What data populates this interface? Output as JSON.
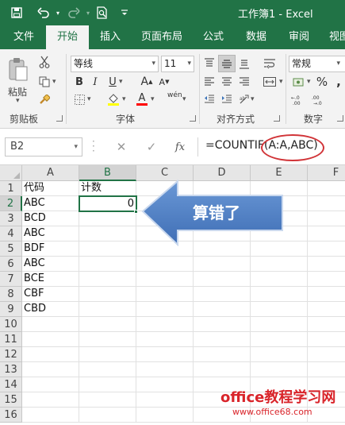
{
  "app": {
    "window_title": "工作簿1 - Excel"
  },
  "quick_access": {
    "save_icon": "save-icon",
    "undo_icon": "undo-icon",
    "redo_icon": "redo-icon",
    "preview_icon": "print-preview-icon",
    "customize_icon": "customize-qat-icon"
  },
  "tabs": [
    {
      "label": "文件"
    },
    {
      "label": "开始"
    },
    {
      "label": "插入"
    },
    {
      "label": "页面布局"
    },
    {
      "label": "公式"
    },
    {
      "label": "数据"
    },
    {
      "label": "审阅"
    },
    {
      "label": "视图"
    }
  ],
  "ribbon": {
    "clipboard": {
      "label": "剪贴板",
      "paste_label": "粘贴"
    },
    "font": {
      "label": "字体",
      "font_name": "等线",
      "font_size": "11",
      "bold": "B",
      "italic": "I",
      "underline": "U",
      "grow": "A",
      "shrink": "A",
      "font_color_glyph": "A",
      "phonetic": "wén",
      "highlight_color": "#ffff00",
      "font_color": "#ff0000"
    },
    "alignment": {
      "label": "对齐方式"
    },
    "number": {
      "label": "数字",
      "format": "常规",
      "percent": "%",
      "comma": ","
    }
  },
  "formula_bar": {
    "name_box": "B2",
    "cancel": "✕",
    "enter": "✓",
    "fx": "fx",
    "formula": "=COUNTIF(A:A,ABC)"
  },
  "sheet": {
    "columns": [
      "A",
      "B",
      "C",
      "D",
      "E",
      "F"
    ],
    "rows": [
      "1",
      "2",
      "3",
      "4",
      "5",
      "6",
      "7",
      "8",
      "9",
      "10",
      "11",
      "12",
      "13",
      "14",
      "15",
      "16"
    ],
    "col_a": [
      "代码",
      "ABC",
      "BCD",
      "ABC",
      "BDF",
      "ABC",
      "BCE",
      "CBF",
      "CBD"
    ],
    "b1": "计数",
    "b2": "0",
    "selected_cell": "B2"
  },
  "callout": {
    "text": "算错了",
    "color": "#4f7fc4"
  },
  "watermark": {
    "line1": "office教程学习网",
    "line2": "www.office68.com"
  }
}
